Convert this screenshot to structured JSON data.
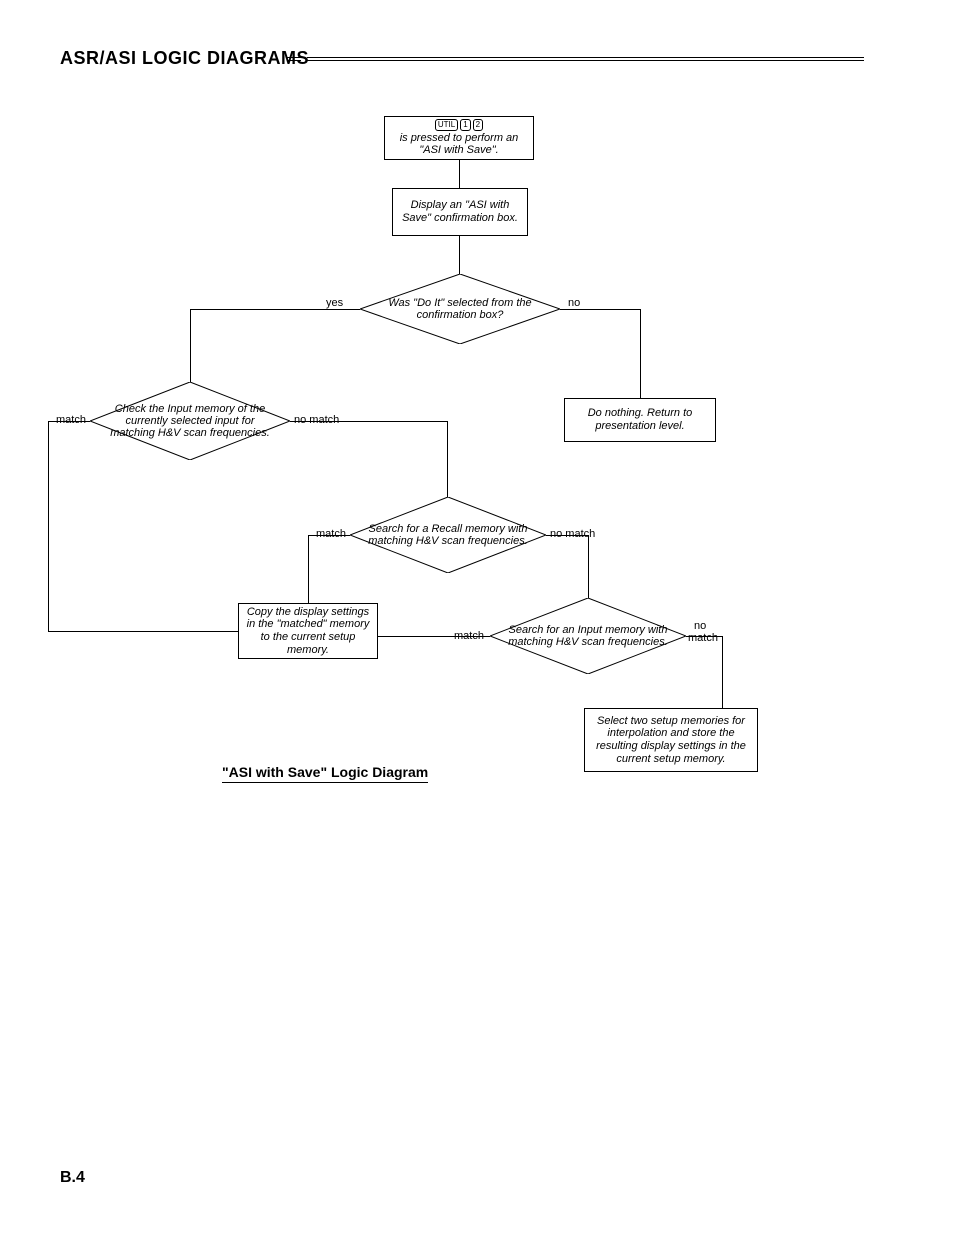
{
  "header": {
    "title": "ASR/ASI LOGIC DIAGRAMS"
  },
  "nodes": {
    "start_keys": "UTIL 1 2",
    "start": "is pressed to perform an \"ASI with Save\".",
    "confirm": "Display an \"ASI with Save\" confirmation box.",
    "doit": "Was \"Do It\" selected from the confirmation box?",
    "check_input": "Check the Input memory of the currently selected input for matching H&V scan frequencies.",
    "do_nothing": "Do nothing. Return to presentation level.",
    "search_recall": "Search for a Recall memory with matching H&V scan frequencies.",
    "copy": "Copy the display settings in the \"matched\" memory to the current setup memory.",
    "search_input": "Search for an Input memory with matching H&V scan frequencies.",
    "interpolate": "Select two setup memories for interpolation and store the resulting display settings in the current setup memory."
  },
  "labels": {
    "yes": "yes",
    "no": "no",
    "match": "match",
    "nomatch": "no match",
    "nomatch_stack1": "no",
    "nomatch_stack2": "match"
  },
  "title": "\"ASI with Save\" Logic Diagram",
  "page": "B.4"
}
